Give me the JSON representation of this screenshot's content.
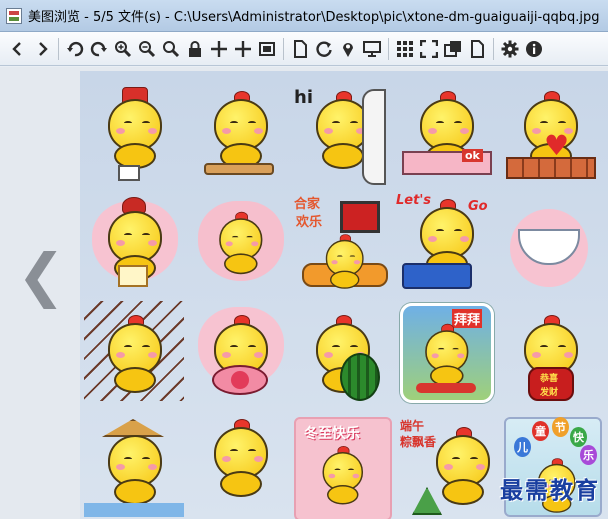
{
  "window": {
    "title": "美图浏览 - 5/5 文件(s) - C:\\Users\\Administrator\\Desktop\\pic\\xtone-dm-guaiguaiji-qqbq.jpg"
  },
  "toolbar": {
    "buttons": [
      {
        "name": "prev-arrow-icon",
        "glyph": "❮"
      },
      {
        "name": "next-arrow-icon",
        "glyph": "❯"
      },
      {
        "name": "rotate-left-icon",
        "glyph": "↶"
      },
      {
        "name": "rotate-right-icon",
        "glyph": "↷"
      },
      {
        "name": "zoom-in-icon",
        "glyph": "zoom"
      },
      {
        "name": "zoom-out-icon",
        "glyph": "zoom"
      },
      {
        "name": "zoom-actual-icon",
        "glyph": "zoom"
      },
      {
        "name": "lock-icon",
        "glyph": "lock"
      },
      {
        "name": "move-icon",
        "glyph": "✛"
      },
      {
        "name": "crosshair-icon",
        "glyph": "✛"
      },
      {
        "name": "fit-window-icon",
        "glyph": "fit"
      },
      {
        "name": "new-page-icon",
        "glyph": "page"
      },
      {
        "name": "refresh-icon",
        "glyph": "↻"
      },
      {
        "name": "location-pin-icon",
        "glyph": "pin"
      },
      {
        "name": "slideshow-icon",
        "glyph": "screen"
      },
      {
        "name": "thumbnail-grid-icon",
        "glyph": "grid"
      },
      {
        "name": "fullscreen-icon",
        "glyph": "full"
      },
      {
        "name": "copy-icon",
        "glyph": "copy"
      },
      {
        "name": "document-icon",
        "glyph": "page"
      },
      {
        "name": "settings-gear-icon",
        "glyph": "⚙"
      },
      {
        "name": "info-icon",
        "glyph": "i"
      }
    ]
  },
  "viewer": {
    "prev_arrow": "❮"
  },
  "stickers": {
    "hi": "hi",
    "ok": "ok",
    "hejia_1": "合家",
    "hejia_2": "欢乐",
    "lets": "Let's",
    "go": "Go",
    "baibai": "拜拜",
    "gongxi_1": "恭喜",
    "gongxi_2": "发财",
    "dongzhi": "冬至快乐",
    "duanwu_1": "端午",
    "duanwu_2": "粽飘香",
    "ertong_1": "儿",
    "ertong_2": "童",
    "ertong_3": "节",
    "ertong_4": "快",
    "ertong_5": "乐"
  },
  "watermark": {
    "text": "最需教育"
  },
  "colors": {
    "title_bar": "#b3cae4",
    "chick_yellow": "#f6c512",
    "comb_red": "#e8352b",
    "cheek_pink": "#f59aa8",
    "watermark_blue": "#1a3fa0"
  }
}
